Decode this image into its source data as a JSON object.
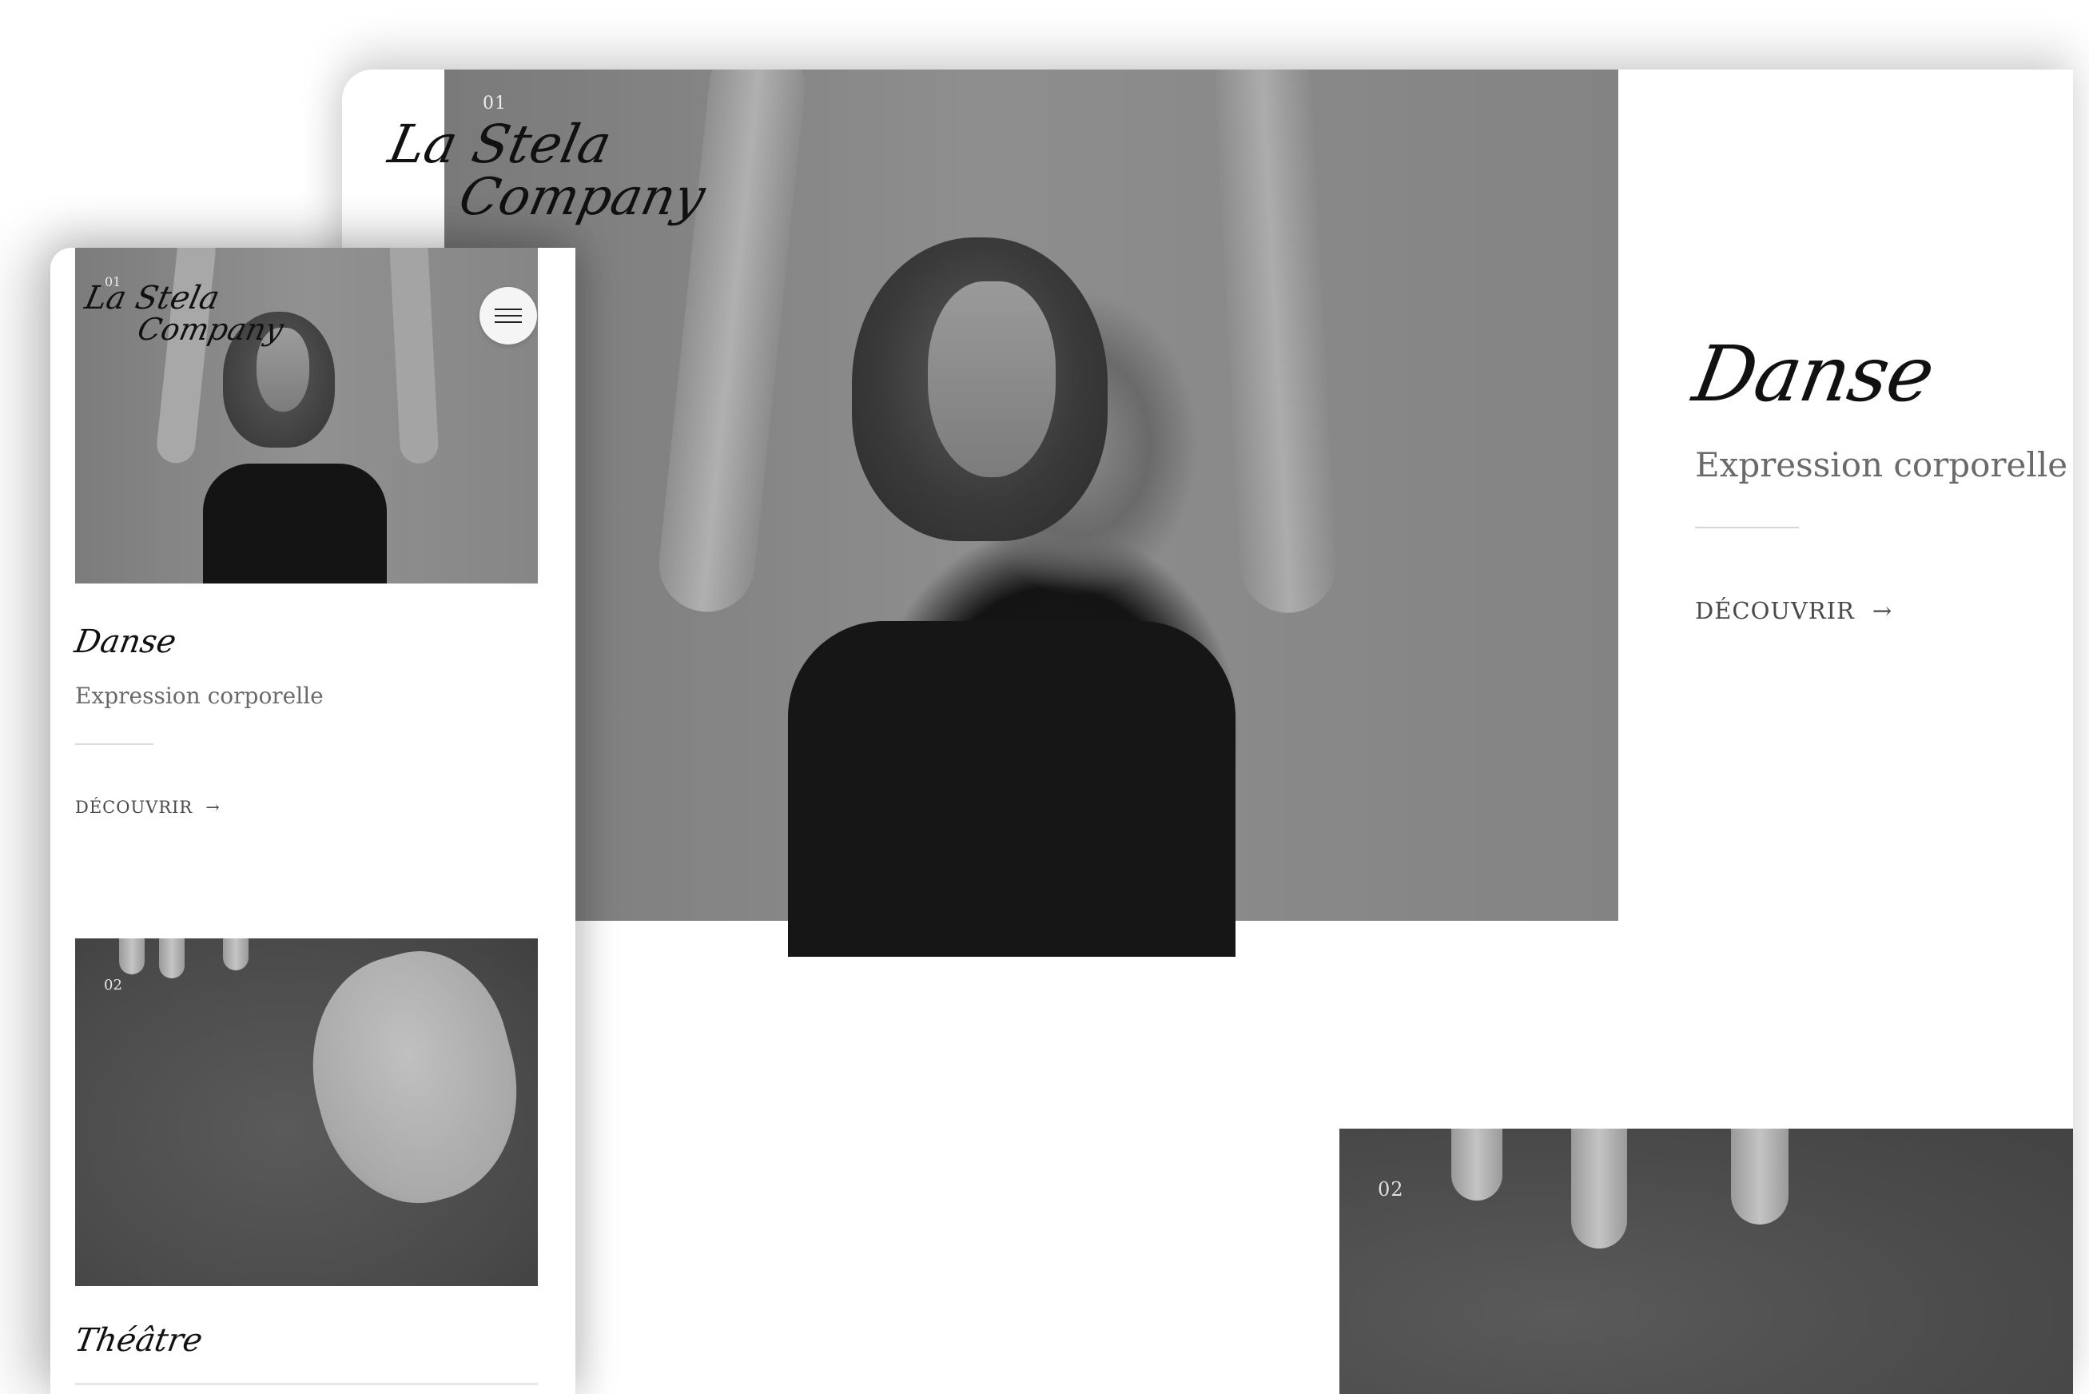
{
  "desktop": {
    "logo": {
      "line1": "La Stela",
      "line2": "Company"
    },
    "slide1": {
      "index": "01",
      "title": "Danse",
      "subtitle": "Expression corporelle",
      "cta": "DÉCOUVRIR",
      "cta_arrow": "→"
    },
    "slide2": {
      "index": "02"
    }
  },
  "mobile": {
    "logo": {
      "line1": "La Stela",
      "line2": "Company"
    },
    "card1": {
      "index": "01",
      "title": "Danse",
      "subtitle": "Expression corporelle",
      "cta": "DÉCOUVRIR",
      "cta_arrow": "→"
    },
    "card2": {
      "index": "02",
      "title": "Théâtre"
    }
  },
  "icons": {
    "menu": "hamburger-menu-icon",
    "arrow": "arrow-right-icon"
  },
  "colors": {
    "text": "#111111",
    "muted": "#6a6a6a",
    "background": "#ffffff"
  }
}
